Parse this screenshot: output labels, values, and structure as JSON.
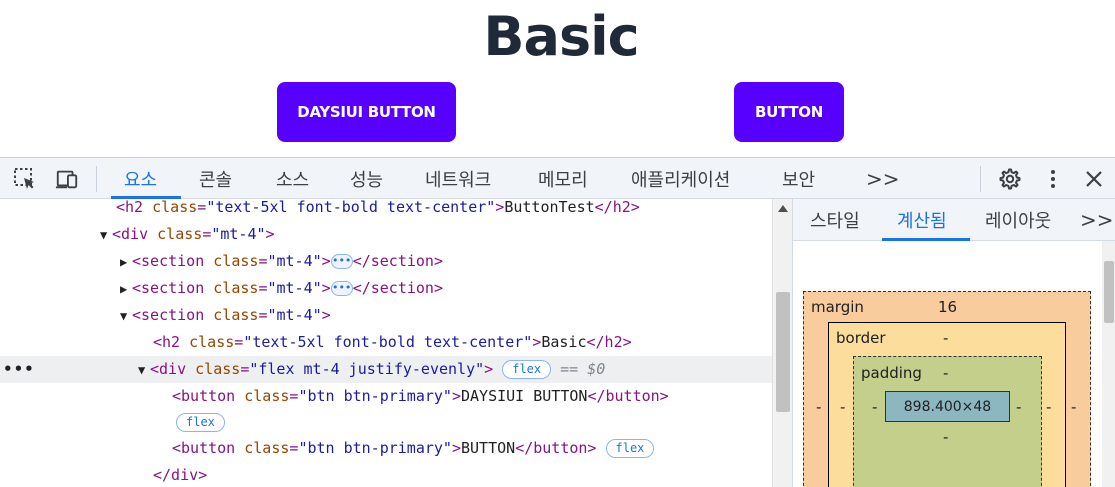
{
  "preview": {
    "title": "Basic",
    "buttons": [
      "DAYSIUI BUTTON",
      "BUTTON"
    ]
  },
  "toolbar": {
    "icons": [
      "inspect-element-icon",
      "device-toolbar-icon"
    ],
    "tabs": [
      "요소",
      "콘솔",
      "소스",
      "성능",
      "네트워크",
      "메모리",
      "애플리케이션",
      "보안"
    ],
    "active_tab": "요소",
    "more": ">>",
    "right_icons": [
      "gear-icon",
      "more-vertical-icon",
      "close-icon"
    ],
    "accent": "#1a73e8"
  },
  "elements": {
    "lines": {
      "l0": {
        "open": "<h2 ",
        "attr": "class",
        "val": "\"text-5xl font-bold text-center\"",
        "text": "ButtonTest",
        "close": "</h2>"
      },
      "l1": {
        "open": "<div ",
        "attr": "class",
        "val": "\"mt-4\"",
        "end": ">"
      },
      "l2": {
        "open": "<section ",
        "attr": "class",
        "val": "\"mt-4\"",
        "ellipsis": "•••",
        "close": "</section>"
      },
      "l3": {
        "open": "<section ",
        "attr": "class",
        "val": "\"mt-4\"",
        "ellipsis": "•••",
        "close": "</section>"
      },
      "l4": {
        "open": "<section ",
        "attr": "class",
        "val": "\"mt-4\"",
        "end": ">"
      },
      "l5": {
        "open": "<h2 ",
        "attr": "class",
        "val": "\"text-5xl font-bold text-center\"",
        "text": "Basic",
        "close": "</h2>"
      },
      "l6": {
        "open": "<div ",
        "attr": "class",
        "val": "\"flex mt-4 justify-evenly\"",
        "end": ">",
        "badge": "flex",
        "eq": "== $0",
        "dots": "•••"
      },
      "l7": {
        "open": "<button ",
        "attr": "class",
        "val": "\"btn btn-primary\"",
        "text": "DAYSIUI BUTTON",
        "close": "</button>"
      },
      "l8": {
        "badge": "flex"
      },
      "l9": {
        "open": "<button ",
        "attr": "class",
        "val": "\"btn btn-primary\"",
        "text": "BUTTON",
        "close": "</button>",
        "badge": "flex"
      },
      "l10": {
        "close": "</div>"
      }
    }
  },
  "side": {
    "tabs": [
      "스타일",
      "계산됨",
      "레이아웃"
    ],
    "active_tab": "계산됨",
    "more": ">>",
    "box_model": {
      "margin_label": "margin",
      "margin_top": "16",
      "margin_left": "-",
      "margin_right": "-",
      "border_label": "border",
      "border_top": "-",
      "border_bottom": "-",
      "border_left": "-",
      "border_right": "-",
      "padding_label": "padding",
      "padding_top": "-",
      "padding_bottom": "-",
      "padding_left": "-",
      "padding_right": "-",
      "content": "898.400×48"
    }
  }
}
